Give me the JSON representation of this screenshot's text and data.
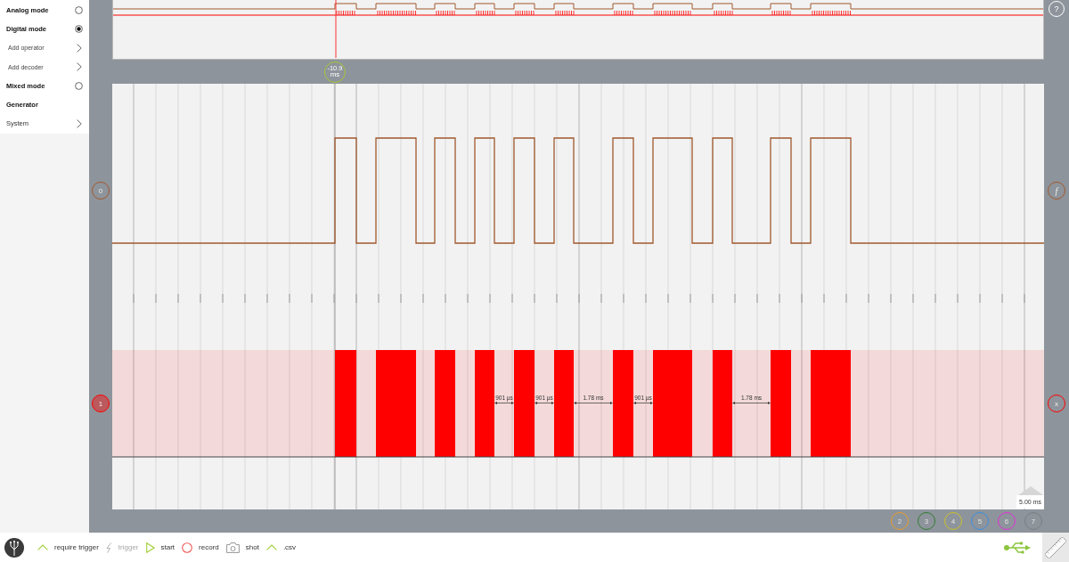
{
  "sidebar": {
    "items": [
      {
        "label": "Analog mode",
        "kind": "mode",
        "selected": false
      },
      {
        "label": "Digital mode",
        "kind": "mode",
        "selected": true,
        "children": [
          {
            "label": "Add operator",
            "kind": "submenu"
          },
          {
            "label": "Add decoder",
            "kind": "submenu"
          }
        ]
      },
      {
        "label": "Mixed mode",
        "kind": "mode",
        "selected": false
      },
      {
        "label": "Generator",
        "kind": "header"
      },
      {
        "label": "System",
        "kind": "submenu"
      }
    ]
  },
  "help": "?",
  "cursor": {
    "value": "-10.9",
    "unit": "ms"
  },
  "channels": [
    {
      "label": "0",
      "kind": "trace",
      "color": "#a0582c",
      "selected": false,
      "side_button": {
        "label": "f",
        "kind": "function"
      }
    },
    {
      "label": "1",
      "kind": "bus",
      "color": "#ff0000",
      "selected": true,
      "side_button": {
        "label": "x",
        "kind": "close"
      }
    }
  ],
  "measurements": [
    "901 µs",
    "901 µs",
    "1.78 ms",
    "901 µs",
    "1.78 ms"
  ],
  "scale": "5.00 ms",
  "channel_buttons": [
    {
      "label": "2",
      "color": "#e89b2a"
    },
    {
      "label": "3",
      "color": "#2f7d32"
    },
    {
      "label": "4",
      "color": "#c9c22a"
    },
    {
      "label": "5",
      "color": "#3c8fe0"
    },
    {
      "label": "6",
      "color": "#e030d8"
    },
    {
      "label": "7",
      "color": "#7a7e84"
    }
  ],
  "toolbar": {
    "items": [
      {
        "label": "require trigger",
        "kind": "toggle",
        "disabled": false
      },
      {
        "label": "trigger",
        "kind": "trigger",
        "disabled": true
      },
      {
        "label": "start",
        "kind": "start",
        "disabled": false
      },
      {
        "label": "record",
        "kind": "record",
        "disabled": false
      },
      {
        "label": "shot",
        "kind": "snapshot",
        "disabled": false
      },
      {
        "label": ".csv",
        "kind": "toggle",
        "disabled": false
      }
    ]
  }
}
